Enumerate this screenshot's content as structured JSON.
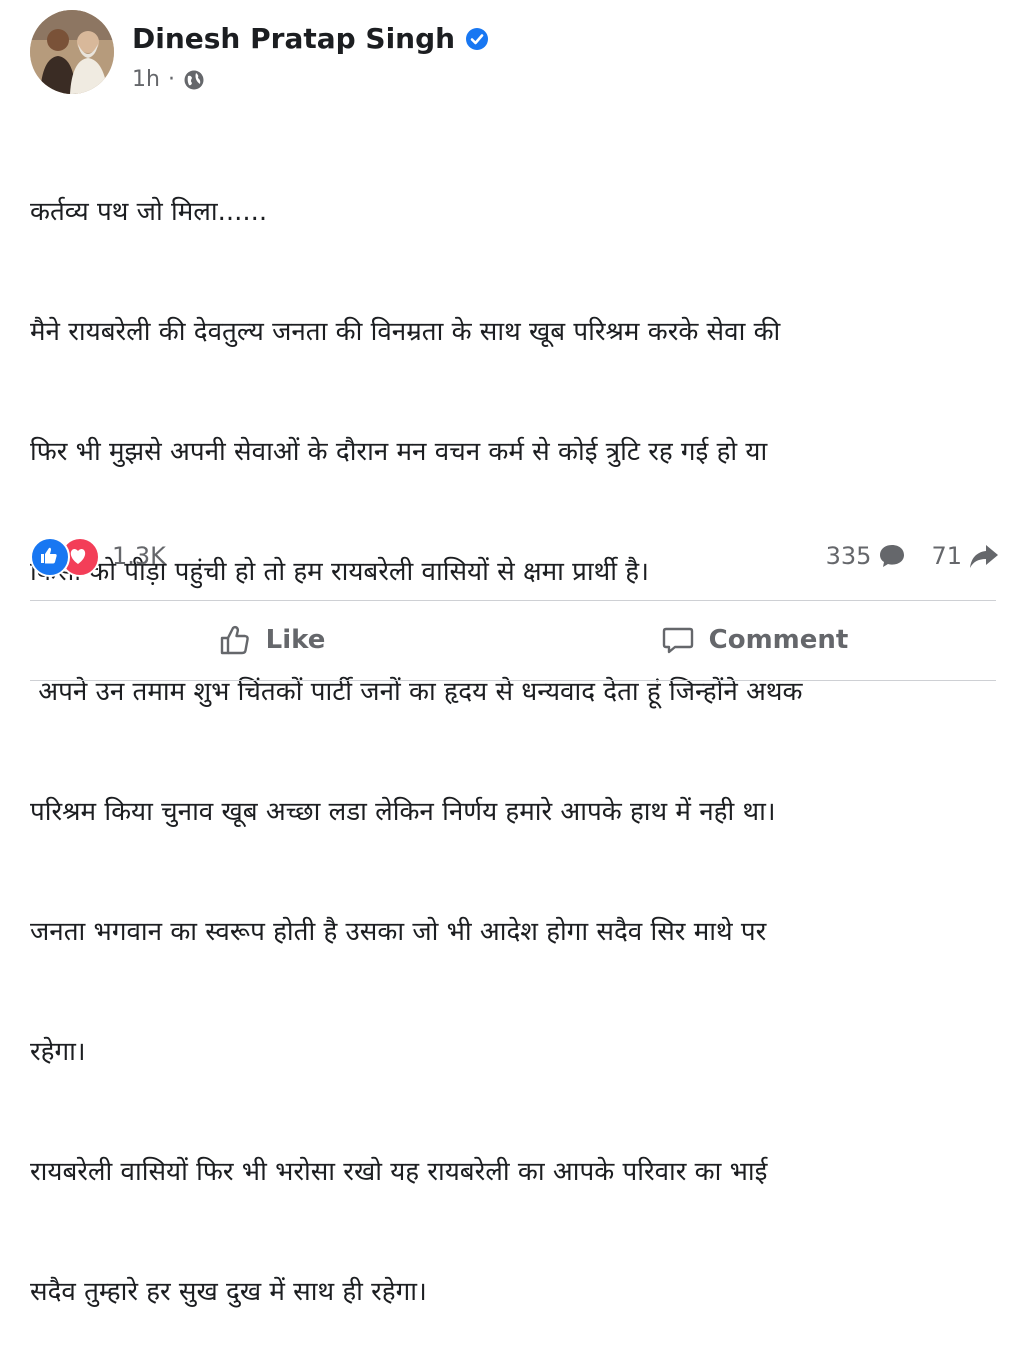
{
  "post": {
    "author": "Dinesh Pratap Singh",
    "time": "1h",
    "separator": "·",
    "lines": [
      "कर्तव्य पथ जो मिला......",
      "मैने रायबरेली की देवतुल्य जनता की विनम्रता के साथ खूब परिश्रम करके सेवा की",
      "फिर भी मुझसे अपनी सेवाओं के दौरान मन वचन कर्म से कोई त्रुटि रह गई हो या",
      "किसी को पीड़ा पहुंची हो तो हम रायबरेली वासियों से क्षमा प्रार्थी है।",
      " अपने उन तमाम शुभ चिंतकों पार्टी जनों का हृदय से धन्यवाद देता हूं जिन्होंने अथक",
      "परिश्रम किया चुनाव खूब अच्छा लडा लेकिन निर्णय हमारे आपके हाथ में नही था।",
      "जनता भगवान का स्वरूप होती है उसका जो भी आदेश होगा सदैव सिर माथे पर",
      "रहेगा।",
      "रायबरेली वासियों फिर भी भरोसा रखो यह रायबरेली का आपके परिवार का भाई",
      "सदैव तुम्हारे हर सुख दुख में साथ ही रहेगा।"
    ]
  },
  "stats": {
    "reactions": "1.3K",
    "comments": "335",
    "shares": "71"
  },
  "actions": {
    "like": "Like",
    "comment": "Comment"
  },
  "colors": {
    "verified": "#1877f2",
    "like": "#1877f2",
    "love": "#f33e58",
    "muted": "#65676b"
  },
  "icons": [
    "verified-badge-icon",
    "globe-icon",
    "like-reaction-icon",
    "love-reaction-icon",
    "comment-icon",
    "share-icon",
    "thumbs-up-icon",
    "comment-bubble-icon"
  ]
}
